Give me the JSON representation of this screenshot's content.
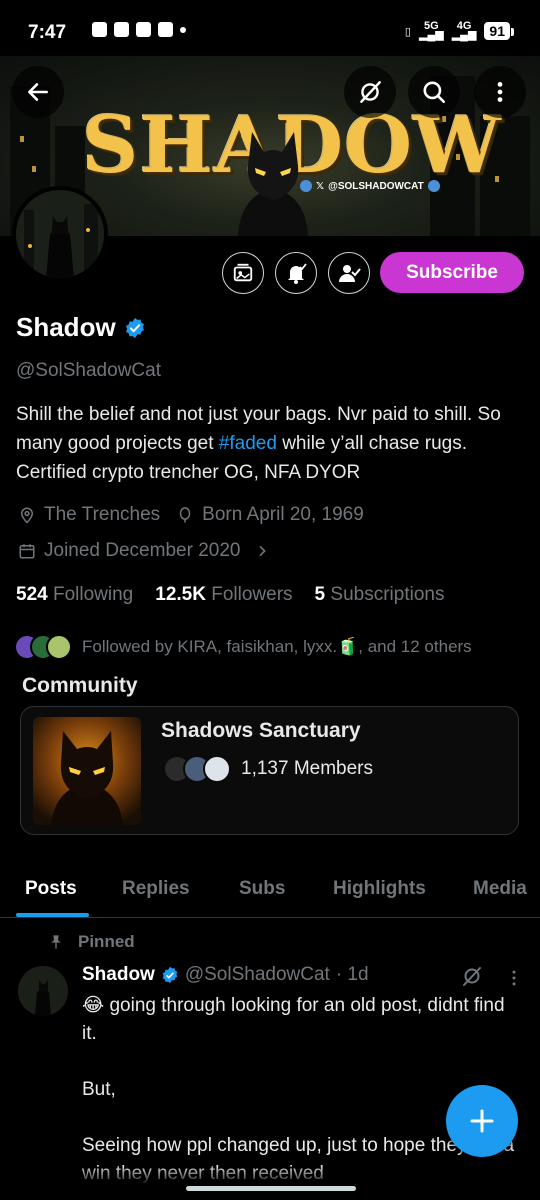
{
  "status_bar": {
    "time": "7:47",
    "net_type_1": "4G",
    "net_type_1_sup": "5G",
    "net_type_2": "4G",
    "battery": "91"
  },
  "banner": {
    "title_text": "SHADOW",
    "handle_text": "@SOLSHADOWCAT"
  },
  "profile": {
    "display_name": "Shadow",
    "handle": "@SolShadowCat",
    "bio_part1": "Shill the belief and not just your bags. Nvr paid to shill. So many good projects get ",
    "bio_hashtag": "#faded",
    "bio_part2": " while y’all chase rugs. Certified crypto trencher OG, NFA DYOR",
    "location": "The Trenches",
    "birthday": "Born April 20, 1969",
    "joined": "Joined December 2020",
    "following_count": "524",
    "following_label": "Following",
    "followers_count": "12.5K",
    "followers_label": "Followers",
    "subscriptions_count": "5",
    "subscriptions_label": "Subscriptions",
    "followed_by": "Followed by KIRA, faisikhan, lyxx.🧃, and 12 others"
  },
  "actions": {
    "subscribe_label": "Subscribe"
  },
  "community": {
    "section_label": "Community",
    "name": "Shadows Sanctuary",
    "members": "1,137 Members"
  },
  "tabs": [
    {
      "label": "Posts",
      "active": true
    },
    {
      "label": "Replies",
      "active": false
    },
    {
      "label": "Subs",
      "active": false
    },
    {
      "label": "Highlights",
      "active": false
    },
    {
      "label": "Media",
      "active": false
    }
  ],
  "post": {
    "pinned_label": "Pinned",
    "author_name": "Shadow",
    "author_handle": "@SolShadowCat",
    "time": "· 1d",
    "line1": "😂 going through looking for an old post, didnt find it.",
    "line2": "But,",
    "line3": "Seeing how ppl changed up, just to hope they get a win they never then received"
  },
  "colors": {
    "accent": "#1d9bf0",
    "subscribe": "#c936d2",
    "muted": "#71767b",
    "background": "#000000"
  },
  "icons": [
    "back-arrow-icon",
    "grok-icon",
    "search-icon",
    "more-vertical-icon",
    "media-icon",
    "bell-icon",
    "follow-check-icon",
    "verified-badge-icon",
    "location-icon",
    "calendar-icon",
    "chevron-right-icon",
    "pin-icon",
    "plus-icon"
  ]
}
